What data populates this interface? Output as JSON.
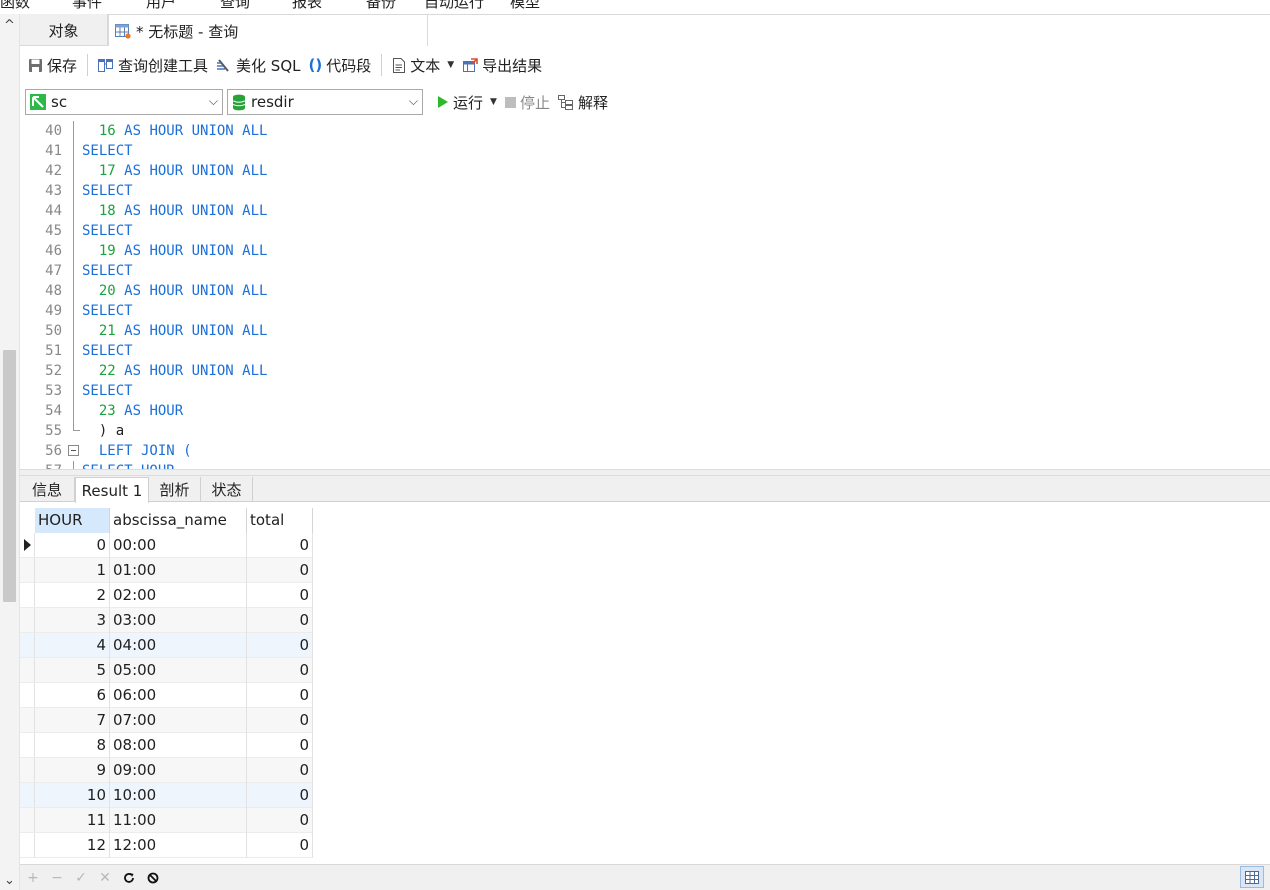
{
  "menubar": [
    "函数",
    "事件",
    "用户",
    "查询",
    "报表",
    "备份",
    "自动运行",
    "模型"
  ],
  "tabs": {
    "objects": "对象",
    "query_title": "* 无标题 - 查询"
  },
  "toolbar": {
    "save": "保存",
    "query_builder": "查询创建工具",
    "beautify_sql": "美化 SQL",
    "code_snippet": "代码段",
    "text": "文本",
    "export_results": "导出结果"
  },
  "toolbar2": {
    "connection": "sc",
    "database": "resdir",
    "run": "运行",
    "stop": "停止",
    "explain": "解释"
  },
  "editor": {
    "lines": [
      {
        "n": "40",
        "indent": "  ",
        "num": "16",
        "rest": "AS HOUR UNION ALL",
        "type": "num"
      },
      {
        "n": "41",
        "text": "SELECT",
        "type": "select"
      },
      {
        "n": "42",
        "indent": "  ",
        "num": "17",
        "rest": "AS HOUR UNION ALL",
        "type": "num"
      },
      {
        "n": "43",
        "text": "SELECT",
        "type": "select"
      },
      {
        "n": "44",
        "indent": "  ",
        "num": "18",
        "rest": "AS HOUR UNION ALL",
        "type": "num"
      },
      {
        "n": "45",
        "text": "SELECT",
        "type": "select"
      },
      {
        "n": "46",
        "indent": "  ",
        "num": "19",
        "rest": "AS HOUR UNION ALL",
        "type": "num"
      },
      {
        "n": "47",
        "text": "SELECT",
        "type": "select"
      },
      {
        "n": "48",
        "indent": "  ",
        "num": "20",
        "rest": "AS HOUR UNION ALL",
        "type": "num"
      },
      {
        "n": "49",
        "text": "SELECT",
        "type": "select"
      },
      {
        "n": "50",
        "indent": "  ",
        "num": "21",
        "rest": "AS HOUR UNION ALL",
        "type": "num"
      },
      {
        "n": "51",
        "text": "SELECT",
        "type": "select"
      },
      {
        "n": "52",
        "indent": "  ",
        "num": "22",
        "rest": "AS HOUR UNION ALL",
        "type": "num"
      },
      {
        "n": "53",
        "text": "SELECT",
        "type": "select"
      },
      {
        "n": "54",
        "indent": "  ",
        "num": "23",
        "rest": "AS HOUR",
        "type": "num"
      },
      {
        "n": "55",
        "text": "  ) a",
        "type": "plain"
      },
      {
        "n": "56",
        "text": "  LEFT JOIN (",
        "type": "join"
      },
      {
        "n": "57",
        "text": "SELECT HOUR",
        "type": "select"
      }
    ]
  },
  "result_tabs": [
    "信息",
    "Result 1",
    "剖析",
    "状态"
  ],
  "grid": {
    "columns": [
      "HOUR",
      "abscissa_name",
      "total"
    ],
    "rows": [
      [
        "0",
        "00:00",
        "0"
      ],
      [
        "1",
        "01:00",
        "0"
      ],
      [
        "2",
        "02:00",
        "0"
      ],
      [
        "3",
        "03:00",
        "0"
      ],
      [
        "4",
        "04:00",
        "0"
      ],
      [
        "5",
        "05:00",
        "0"
      ],
      [
        "6",
        "06:00",
        "0"
      ],
      [
        "7",
        "07:00",
        "0"
      ],
      [
        "8",
        "08:00",
        "0"
      ],
      [
        "9",
        "09:00",
        "0"
      ],
      [
        "10",
        "10:00",
        "0"
      ],
      [
        "11",
        "11:00",
        "0"
      ],
      [
        "12",
        "12:00",
        "0"
      ]
    ]
  },
  "colors": {
    "keyword": "#1b6fd8",
    "number": "#1aa33c",
    "run_green": "#2fb82f",
    "db_green": "#27a33a"
  }
}
